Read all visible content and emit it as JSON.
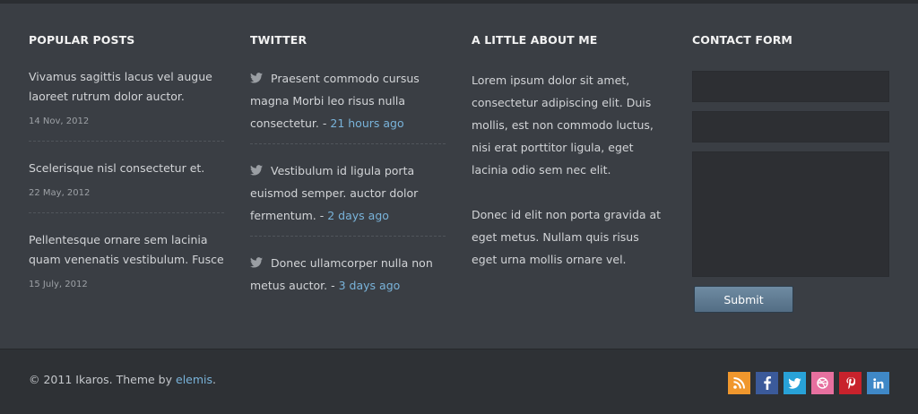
{
  "popular_posts": {
    "heading": "POPULAR POSTS",
    "items": [
      {
        "title": "Vivamus sagittis lacus vel augue laoreet rutrum dolor auctor.",
        "date": "14 Nov, 2012"
      },
      {
        "title": "Scelerisque nisl consectetur et.",
        "date": "22 May, 2012"
      },
      {
        "title": "Pellentesque ornare sem lacinia quam venenatis vestibulum. Fusce",
        "date": "15 July, 2012"
      }
    ]
  },
  "twitter": {
    "heading": "TWITTER",
    "icon": "twitter-bird-icon",
    "items": [
      {
        "text": "Praesent commodo cursus magna Morbi leo risus nulla consectetur. -",
        "time": "21 hours ago"
      },
      {
        "text": "Vestibulum id ligula porta euismod semper. auctor dolor fermentum. -",
        "time": "2 days ago"
      },
      {
        "text": "Donec ullamcorper nulla non metus auctor. -",
        "time": "3 days ago"
      }
    ]
  },
  "about": {
    "heading": "A LITTLE ABOUT ME",
    "paragraphs": [
      "Lorem ipsum dolor sit amet, consectetur adipiscing elit. Duis mollis, est non commodo luctus, nisi erat porttitor ligula, eget lacinia odio sem nec elit.",
      "Donec id elit non porta gravida at eget metus. Nullam quis risus eget urna mollis ornare vel."
    ]
  },
  "contact": {
    "heading": "CONTACT FORM",
    "name_value": "",
    "email_value": "",
    "message_value": "",
    "submit_label": "Submit"
  },
  "footer": {
    "copyright_prefix": "© 2011 Ikaros. Theme by",
    "author_link": "elemis",
    "copyright_suffix": ".",
    "social": [
      {
        "name": "rss",
        "icon": "rss-icon",
        "color": "#f0972d"
      },
      {
        "name": "facebook",
        "icon": "facebook-icon",
        "color": "#3b5a9a"
      },
      {
        "name": "twitter",
        "icon": "twitter-icon",
        "color": "#28a2d8"
      },
      {
        "name": "dribbble",
        "icon": "dribbble-icon",
        "color": "#e7709f"
      },
      {
        "name": "pinterest",
        "icon": "pinterest-icon",
        "color": "#c8222c"
      },
      {
        "name": "linkedin",
        "icon": "linkedin-icon",
        "color": "#3f88c7"
      }
    ]
  },
  "colors": {
    "background": "#3a3e44",
    "footer_background": "#2e3135",
    "link": "#79b3da",
    "heading": "#f2f2f2"
  }
}
